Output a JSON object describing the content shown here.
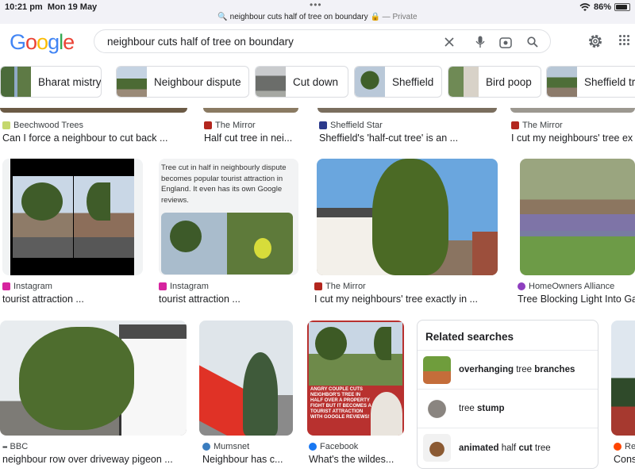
{
  "status": {
    "time": "10:21 pm",
    "date": "Mon 19 May",
    "battery": "86%",
    "battery_level": 0.86
  },
  "url": {
    "text": "neighbour cuts half of tree on boundary",
    "private": "— Private"
  },
  "logo": "Google",
  "search": {
    "value": "neighbour cuts half of tree on boundary"
  },
  "chips": [
    "Bharat mistry",
    "Neighbour dispute",
    "Cut down",
    "Sheffield",
    "Bird poop",
    "Sheffield tr"
  ],
  "row1": [
    {
      "source": "Beechwood Trees",
      "title": "Can I force a neighbour to cut back ..."
    },
    {
      "source": "The Mirror",
      "title": "Half cut tree in nei..."
    },
    {
      "source": "Sheffield Star",
      "title": "Sheffield's 'half-cut tree' is an ..."
    },
    {
      "source": "The Mirror",
      "title": "I cut my neighbours' tree ex"
    }
  ],
  "row2": [
    {
      "source": "Instagram",
      "title": "tourist attraction ..."
    },
    {
      "source": "Instagram",
      "title": "tourist attraction ...",
      "overlay": "Tree cut in half in neighbourly dispute becomes popular tourist attraction in England. It even has its own Google reviews."
    },
    {
      "source": "The Mirror",
      "title": "I cut my neighbours' tree exactly in ..."
    },
    {
      "source": "HomeOwners Alliance",
      "title": "Tree Blocking Light Into Ga"
    }
  ],
  "row3": [
    {
      "source": "BBC",
      "title": "neighbour row over driveway pigeon ..."
    },
    {
      "source": "Mumsnet",
      "title": "Neighbour has c..."
    },
    {
      "source": "Facebook",
      "title": "What's the wildes...",
      "overlay": "ANGRY COUPLE CUTS NEIGHBOR'S TREE IN HALF OVER A PROPERTY FIGHT BUT IT BECOMES A TOURIST ATTRACTION WITH GOOGLE REVIEWS!"
    },
    {
      "source": "Re",
      "title": "Cons"
    }
  ],
  "related": {
    "heading": "Related searches",
    "items": [
      {
        "bold1": "overhanging",
        "normal": " tree ",
        "bold2": "branches"
      },
      {
        "bold1": "",
        "normal": "tree ",
        "bold2": "stump"
      },
      {
        "bold1": "animated",
        "normal": " half ",
        "bold2": "cut",
        "tail": " tree"
      }
    ]
  },
  "colors": {
    "accent": "#1a73e8",
    "google_blue": "#4285f4",
    "google_red": "#ea4335",
    "google_yellow": "#fbbc05",
    "google_green": "#34a853"
  }
}
